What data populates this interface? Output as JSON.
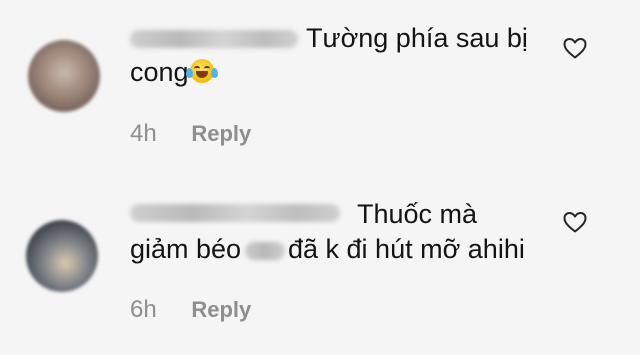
{
  "comments": [
    {
      "line1": "Tường phía sau bị",
      "line2": "cong",
      "emoji": "face-with-tears-of-joy-emoji",
      "time": "4h",
      "reply_label": "Reply",
      "like_icon": "heart-outline-icon"
    },
    {
      "line1": "Thuốc mà",
      "line2a": "giảm béo",
      "line2b": "đã k đi hút mỡ ahihi",
      "time": "6h",
      "reply_label": "Reply",
      "like_icon": "heart-outline-icon"
    }
  ],
  "colors": {
    "background": "#f5f5f5",
    "text": "#141414",
    "meta": "#8e8e8e"
  }
}
